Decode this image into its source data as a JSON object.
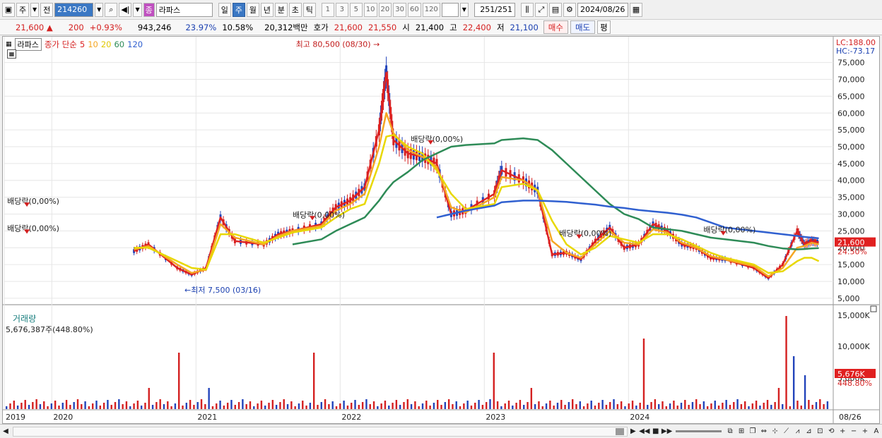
{
  "toolbar": {
    "period_type": "주",
    "prev_label": "전",
    "code": "214260",
    "name_badge": "종",
    "stock_name": "라파스",
    "periods": [
      "일",
      "주",
      "월",
      "년",
      "분",
      "초",
      "틱"
    ],
    "active_period": "주",
    "intervals": [
      "1",
      "3",
      "5",
      "10",
      "20",
      "30",
      "60",
      "120"
    ],
    "count_value": "251",
    "count_total": "/251",
    "date": "2024/08/26"
  },
  "quote": {
    "price": "21,600",
    "change_arrow": "▲",
    "change": "200",
    "change_pct": "+0.93%",
    "volume": "943,246",
    "turnover_rate": "23.97%",
    "vol_ratio": "10.58%",
    "amount": "20,312백만",
    "bid_label": "호가",
    "ask_price": "21,600",
    "bid_price": "21,550",
    "open_label": "시",
    "open": "21,400",
    "high_label": "고",
    "high": "22,400",
    "low_label": "저",
    "low": "21,100",
    "buy_label": "매수",
    "sell_label": "매도",
    "eval_label": "평"
  },
  "legend": {
    "stock_tag": "라파스",
    "ma_label": "종가 단순",
    "ma_periods": [
      "5",
      "10",
      "20",
      "60",
      "120"
    ],
    "ma_colors": [
      "#dd2222",
      "#f5a623",
      "#e8d800",
      "#2e8b57",
      "#3060d0"
    ]
  },
  "indicators": {
    "lc": "LC:188.00",
    "hc": "HC:-73.17",
    "current_price_tag": "21,600",
    "current_pct_tag": "24.50%"
  },
  "annotations": {
    "high": "최고 80,500 (08/30)",
    "low": "최저 7,500 (03/16)",
    "dividend_1": "배당락(0,00%)",
    "dividend_2": "배당락(0,00%)",
    "dividend_3": "배당락(0,00%)",
    "dividend_4": "배당락(0,00%)",
    "dividend_5": "배당락(0,00%)",
    "dividend_6": "배당락(0,00%)"
  },
  "volume_panel": {
    "title": "거래량",
    "summary": "5,676,387주(448.80%)",
    "current_tag": "5,676K",
    "current_pct": "448.80%",
    "axis_labels": [
      "15,000K",
      "10,000K",
      "5,000K"
    ]
  },
  "x_axis": {
    "labels": [
      "2019",
      "2020",
      "2021",
      "2022",
      "2023",
      "2024"
    ],
    "last_label": "08/26"
  },
  "chart_data": {
    "type": "line",
    "ylim": [
      5000,
      80500
    ],
    "y_ticks": [
      5000,
      10000,
      15000,
      20000,
      25000,
      30000,
      35000,
      40000,
      45000,
      50000,
      55000,
      60000,
      65000,
      70000,
      75000
    ],
    "y_tick_labels": [
      "5,000",
      "10,000",
      "15,000",
      "20,000",
      "25,000",
      "30,000",
      "35,000",
      "40,000",
      "45,000",
      "50,000",
      "55,000",
      "60,000",
      "65,000",
      "70,000",
      "75,000"
    ],
    "x_year_labels": [
      "2019",
      "2020",
      "2021",
      "2022",
      "2023",
      "2024"
    ],
    "x": [
      2019.9,
      2020.0,
      2020.2,
      2020.3,
      2020.4,
      2020.5,
      2020.6,
      2020.8,
      2020.9,
      2021.0,
      2021.2,
      2021.3,
      2021.4,
      2021.5,
      2021.6,
      2021.65,
      2021.7,
      2021.8,
      2021.9,
      2022.0,
      2022.1,
      2022.2,
      2022.4,
      2022.45,
      2022.6,
      2022.7,
      2022.8,
      2022.9,
      2023.0,
      2023.1,
      2023.2,
      2023.3,
      2023.4,
      2023.5,
      2023.6,
      2023.7,
      2023.8,
      2023.9,
      2024.0,
      2024.2,
      2024.3,
      2024.4,
      2024.5,
      2024.55,
      2024.6,
      2024.65
    ],
    "series": [
      {
        "name": "5",
        "values": [
          19000,
          21000,
          14000,
          12000,
          14000,
          29000,
          22000,
          21000,
          24000,
          25000,
          27000,
          32000,
          34000,
          38000,
          55000,
          72000,
          52000,
          48000,
          47000,
          45000,
          30000,
          31000,
          36000,
          43000,
          40000,
          37000,
          18000,
          18500,
          16500,
          22000,
          26000,
          20000,
          21000,
          27000,
          25000,
          21000,
          20000,
          17000,
          16500,
          14000,
          11000,
          15000,
          25000,
          21000,
          22000,
          21600
        ]
      },
      {
        "name": "10",
        "values": [
          19500,
          20500,
          15000,
          12500,
          13500,
          27000,
          23000,
          21000,
          23500,
          25000,
          26500,
          31000,
          33000,
          36000,
          50000,
          60000,
          54000,
          49000,
          47000,
          44000,
          32000,
          30500,
          35000,
          41000,
          40000,
          37000,
          22000,
          18500,
          17000,
          21000,
          25000,
          21500,
          21000,
          25500,
          24500,
          21500,
          20000,
          17500,
          16500,
          14500,
          11500,
          14000,
          20000,
          20500,
          21500,
          21000
        ]
      },
      {
        "name": "20",
        "values": [
          20000,
          20000,
          16000,
          14000,
          13500,
          24000,
          24000,
          21500,
          23000,
          24500,
          26000,
          29000,
          31500,
          33000,
          45000,
          53000,
          53500,
          50000,
          48000,
          43000,
          36000,
          31500,
          33000,
          38000,
          39000,
          37000,
          28000,
          21000,
          18000,
          20000,
          23500,
          22500,
          21500,
          24000,
          24000,
          22500,
          20500,
          18500,
          17000,
          15000,
          12500,
          13000,
          16000,
          17000,
          17000,
          16000
        ]
      },
      {
        "name": "60",
        "values": [
          null,
          null,
          null,
          null,
          null,
          null,
          null,
          null,
          null,
          21000,
          22500,
          25000,
          27000,
          29000,
          34000,
          37000,
          39500,
          42500,
          46000,
          48000,
          50000,
          50500,
          51000,
          52000,
          52500,
          52000,
          49000,
          45000,
          41000,
          37000,
          33000,
          30000,
          28500,
          26000,
          25500,
          25000,
          24000,
          23000,
          22500,
          21500,
          20500,
          19800,
          19500,
          19600,
          19800,
          19900
        ]
      },
      {
        "name": "120",
        "values": [
          null,
          null,
          null,
          null,
          null,
          null,
          null,
          null,
          null,
          null,
          null,
          null,
          null,
          null,
          null,
          null,
          null,
          null,
          null,
          29000,
          30000,
          31000,
          32500,
          33500,
          34000,
          34000,
          33800,
          33600,
          33200,
          32800,
          32200,
          31800,
          31200,
          30800,
          30400,
          29800,
          29000,
          27500,
          26000,
          25000,
          24500,
          24000,
          23500,
          23200,
          23000,
          22800
        ]
      }
    ]
  }
}
